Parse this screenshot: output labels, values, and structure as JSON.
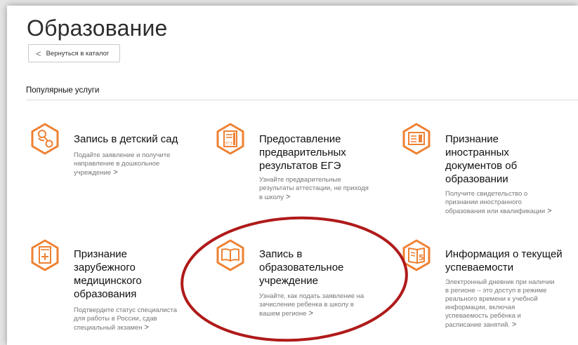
{
  "page": {
    "title": "Образование",
    "back_button": "Вернуться в каталог",
    "section_title": "Популярные услуги"
  },
  "accent_color": "#ee8133",
  "highlight_color": "#b01a1a",
  "services": [
    {
      "icon": "baby-rattle-icon",
      "name_lines": [
        "Запись в детский сад"
      ],
      "desc_lines": [
        "Подайте заявление и получите",
        "направление в дошкольное",
        "учреждение"
      ]
    },
    {
      "icon": "ege-document-icon",
      "name_lines": [
        "Предоставление",
        "предварительных",
        "результатов ЕГЭ"
      ],
      "desc_lines": [
        "Узнайте предварительные",
        "результаты аттестации, не приходя",
        "в школу"
      ]
    },
    {
      "icon": "foreign-document-icon",
      "name_lines": [
        "Признание",
        "иностранных",
        "документов об",
        "образовании"
      ],
      "desc_lines": [
        "Получите свидетельство о",
        "признании иностранного",
        "образования или квалификации"
      ]
    },
    {
      "icon": "medical-document-icon",
      "name_lines": [
        "Признание",
        "зарубежного",
        "медицинского",
        "образования"
      ],
      "desc_lines": [
        "Подтвердите статус специалиста",
        "для работы в России, сдав",
        "специальный экзамен"
      ]
    },
    {
      "icon": "open-book-icon",
      "name_lines": [
        "Запись в",
        "образовательное",
        "учреждение"
      ],
      "desc_lines": [
        "Узнайте, как подать заявление на",
        "зачисление ребенка в школу в",
        "вашем регионе"
      ]
    },
    {
      "icon": "grade-diary-icon",
      "name_lines": [
        "Информация о текущей",
        "успеваемости"
      ],
      "desc_lines": [
        "Электронный дневник при наличии",
        "в регионе – это доступ в режиме",
        "реального времени к учебной",
        "информации, включая",
        "успеваемость ребёнка и",
        "расписание занятий."
      ]
    }
  ],
  "arrow_glyph": ">"
}
